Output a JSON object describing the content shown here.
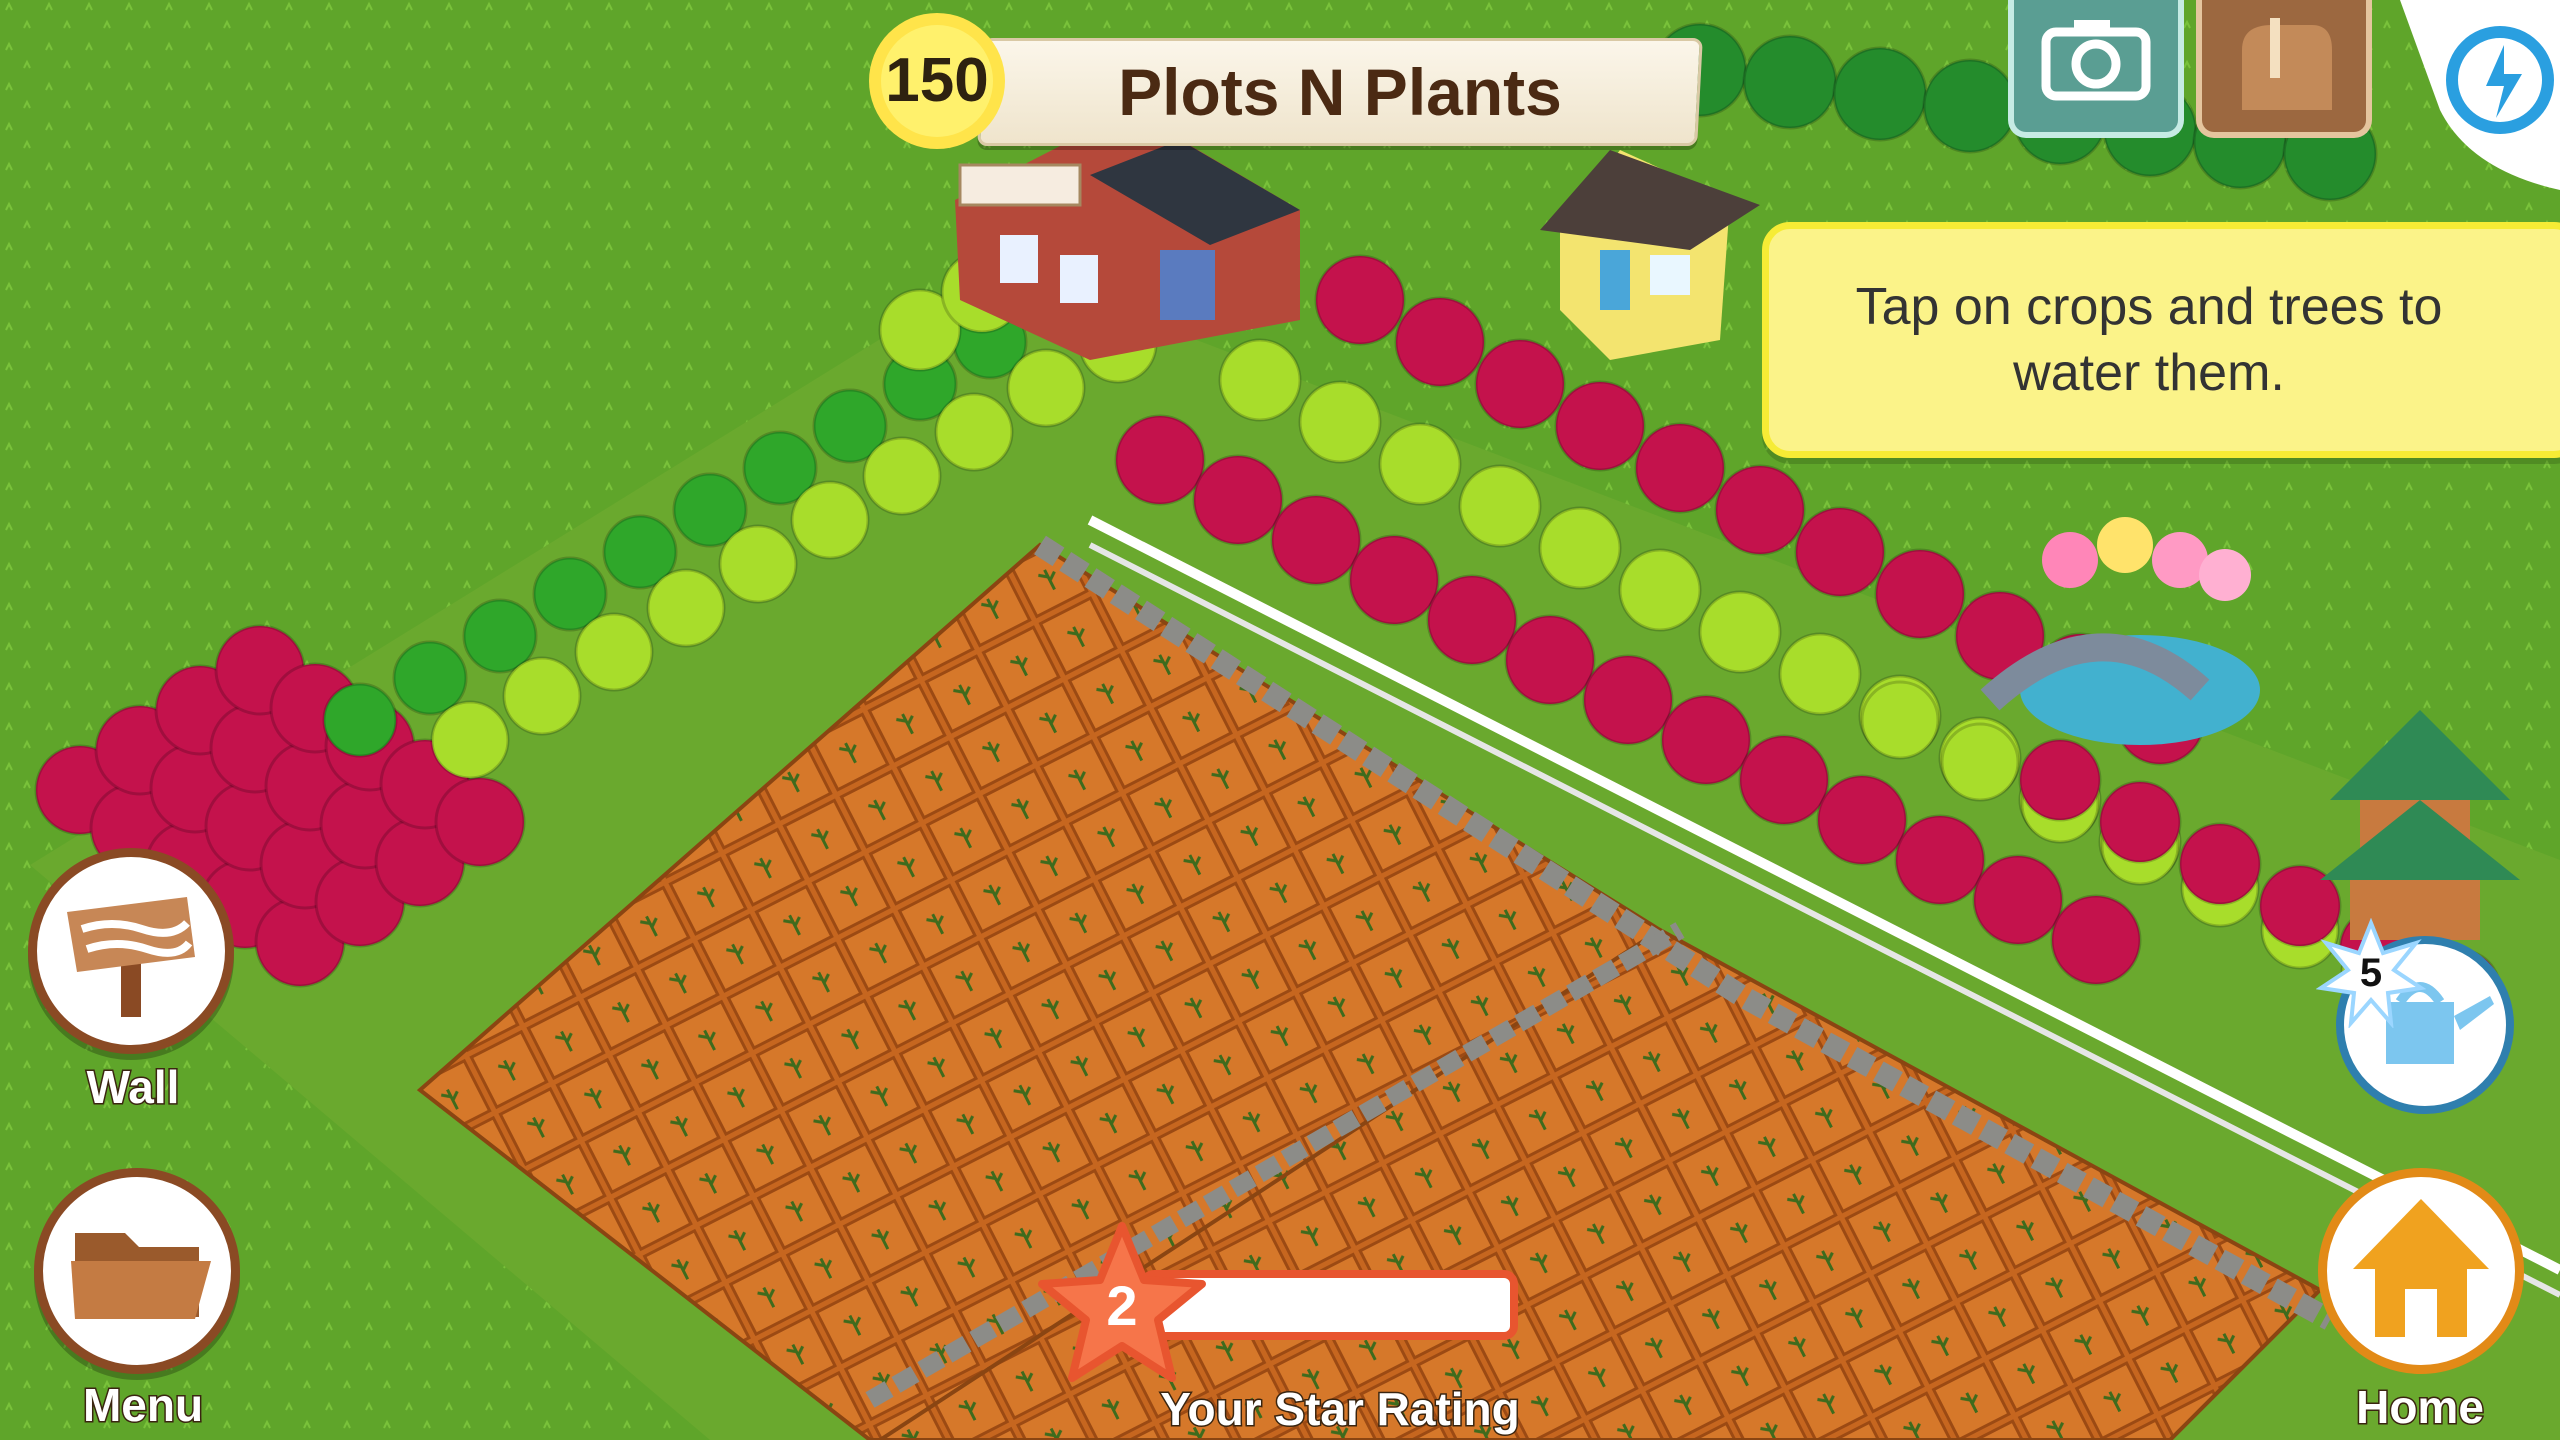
{
  "header": {
    "player_level": "150",
    "farm_name": "Plots N Plants"
  },
  "tooltip": {
    "text": "Tap on crops and trees to water them."
  },
  "buttons": {
    "wall": "Wall",
    "menu": "Menu",
    "home": "Home"
  },
  "watering": {
    "count": "5"
  },
  "rating": {
    "label": "Your Star Rating",
    "level": "2",
    "progress": 0.0
  },
  "icons": [
    "camera-icon",
    "mailbox-icon",
    "quick-action-icon",
    "signpost-icon",
    "folder-icon",
    "house-icon",
    "watering-can-icon",
    "star-icon"
  ],
  "colors": {
    "grass": "#5fa52a",
    "soil": "#c6661f",
    "magenta_tree": "#c4124c",
    "lime_tree": "#a8dd2b",
    "green_tree": "#2fa72a",
    "tooltip_bg": "#fbf389",
    "rating_accent": "#e8552f"
  }
}
